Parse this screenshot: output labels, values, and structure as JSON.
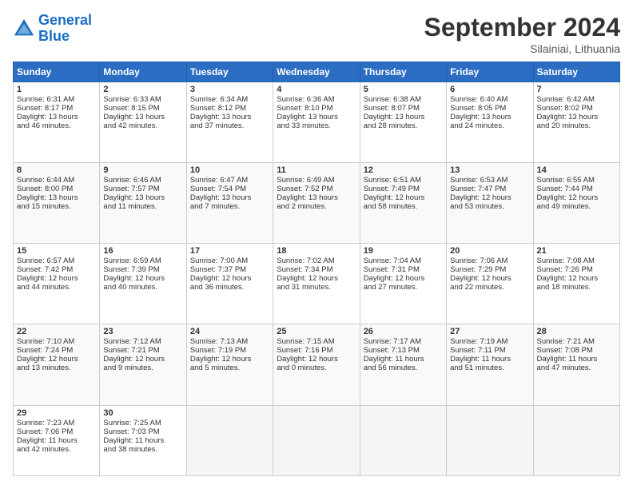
{
  "header": {
    "logo_line1": "General",
    "logo_line2": "Blue",
    "month": "September 2024",
    "location": "Silainiai, Lithuania"
  },
  "weekdays": [
    "Sunday",
    "Monday",
    "Tuesday",
    "Wednesday",
    "Thursday",
    "Friday",
    "Saturday"
  ],
  "weeks": [
    [
      {
        "day": "1",
        "lines": [
          "Sunrise: 6:31 AM",
          "Sunset: 8:17 PM",
          "Daylight: 13 hours",
          "and 46 minutes."
        ]
      },
      {
        "day": "2",
        "lines": [
          "Sunrise: 6:33 AM",
          "Sunset: 8:15 PM",
          "Daylight: 13 hours",
          "and 42 minutes."
        ]
      },
      {
        "day": "3",
        "lines": [
          "Sunrise: 6:34 AM",
          "Sunset: 8:12 PM",
          "Daylight: 13 hours",
          "and 37 minutes."
        ]
      },
      {
        "day": "4",
        "lines": [
          "Sunrise: 6:36 AM",
          "Sunset: 8:10 PM",
          "Daylight: 13 hours",
          "and 33 minutes."
        ]
      },
      {
        "day": "5",
        "lines": [
          "Sunrise: 6:38 AM",
          "Sunset: 8:07 PM",
          "Daylight: 13 hours",
          "and 28 minutes."
        ]
      },
      {
        "day": "6",
        "lines": [
          "Sunrise: 6:40 AM",
          "Sunset: 8:05 PM",
          "Daylight: 13 hours",
          "and 24 minutes."
        ]
      },
      {
        "day": "7",
        "lines": [
          "Sunrise: 6:42 AM",
          "Sunset: 8:02 PM",
          "Daylight: 13 hours",
          "and 20 minutes."
        ]
      }
    ],
    [
      {
        "day": "8",
        "lines": [
          "Sunrise: 6:44 AM",
          "Sunset: 8:00 PM",
          "Daylight: 13 hours",
          "and 15 minutes."
        ]
      },
      {
        "day": "9",
        "lines": [
          "Sunrise: 6:46 AM",
          "Sunset: 7:57 PM",
          "Daylight: 13 hours",
          "and 11 minutes."
        ]
      },
      {
        "day": "10",
        "lines": [
          "Sunrise: 6:47 AM",
          "Sunset: 7:54 PM",
          "Daylight: 13 hours",
          "and 7 minutes."
        ]
      },
      {
        "day": "11",
        "lines": [
          "Sunrise: 6:49 AM",
          "Sunset: 7:52 PM",
          "Daylight: 13 hours",
          "and 2 minutes."
        ]
      },
      {
        "day": "12",
        "lines": [
          "Sunrise: 6:51 AM",
          "Sunset: 7:49 PM",
          "Daylight: 12 hours",
          "and 58 minutes."
        ]
      },
      {
        "day": "13",
        "lines": [
          "Sunrise: 6:53 AM",
          "Sunset: 7:47 PM",
          "Daylight: 12 hours",
          "and 53 minutes."
        ]
      },
      {
        "day": "14",
        "lines": [
          "Sunrise: 6:55 AM",
          "Sunset: 7:44 PM",
          "Daylight: 12 hours",
          "and 49 minutes."
        ]
      }
    ],
    [
      {
        "day": "15",
        "lines": [
          "Sunrise: 6:57 AM",
          "Sunset: 7:42 PM",
          "Daylight: 12 hours",
          "and 44 minutes."
        ]
      },
      {
        "day": "16",
        "lines": [
          "Sunrise: 6:59 AM",
          "Sunset: 7:39 PM",
          "Daylight: 12 hours",
          "and 40 minutes."
        ]
      },
      {
        "day": "17",
        "lines": [
          "Sunrise: 7:00 AM",
          "Sunset: 7:37 PM",
          "Daylight: 12 hours",
          "and 36 minutes."
        ]
      },
      {
        "day": "18",
        "lines": [
          "Sunrise: 7:02 AM",
          "Sunset: 7:34 PM",
          "Daylight: 12 hours",
          "and 31 minutes."
        ]
      },
      {
        "day": "19",
        "lines": [
          "Sunrise: 7:04 AM",
          "Sunset: 7:31 PM",
          "Daylight: 12 hours",
          "and 27 minutes."
        ]
      },
      {
        "day": "20",
        "lines": [
          "Sunrise: 7:06 AM",
          "Sunset: 7:29 PM",
          "Daylight: 12 hours",
          "and 22 minutes."
        ]
      },
      {
        "day": "21",
        "lines": [
          "Sunrise: 7:08 AM",
          "Sunset: 7:26 PM",
          "Daylight: 12 hours",
          "and 18 minutes."
        ]
      }
    ],
    [
      {
        "day": "22",
        "lines": [
          "Sunrise: 7:10 AM",
          "Sunset: 7:24 PM",
          "Daylight: 12 hours",
          "and 13 minutes."
        ]
      },
      {
        "day": "23",
        "lines": [
          "Sunrise: 7:12 AM",
          "Sunset: 7:21 PM",
          "Daylight: 12 hours",
          "and 9 minutes."
        ]
      },
      {
        "day": "24",
        "lines": [
          "Sunrise: 7:13 AM",
          "Sunset: 7:19 PM",
          "Daylight: 12 hours",
          "and 5 minutes."
        ]
      },
      {
        "day": "25",
        "lines": [
          "Sunrise: 7:15 AM",
          "Sunset: 7:16 PM",
          "Daylight: 12 hours",
          "and 0 minutes."
        ]
      },
      {
        "day": "26",
        "lines": [
          "Sunrise: 7:17 AM",
          "Sunset: 7:13 PM",
          "Daylight: 11 hours",
          "and 56 minutes."
        ]
      },
      {
        "day": "27",
        "lines": [
          "Sunrise: 7:19 AM",
          "Sunset: 7:11 PM",
          "Daylight: 11 hours",
          "and 51 minutes."
        ]
      },
      {
        "day": "28",
        "lines": [
          "Sunrise: 7:21 AM",
          "Sunset: 7:08 PM",
          "Daylight: 11 hours",
          "and 47 minutes."
        ]
      }
    ],
    [
      {
        "day": "29",
        "lines": [
          "Sunrise: 7:23 AM",
          "Sunset: 7:06 PM",
          "Daylight: 11 hours",
          "and 42 minutes."
        ]
      },
      {
        "day": "30",
        "lines": [
          "Sunrise: 7:25 AM",
          "Sunset: 7:03 PM",
          "Daylight: 11 hours",
          "and 38 minutes."
        ]
      },
      null,
      null,
      null,
      null,
      null
    ]
  ]
}
